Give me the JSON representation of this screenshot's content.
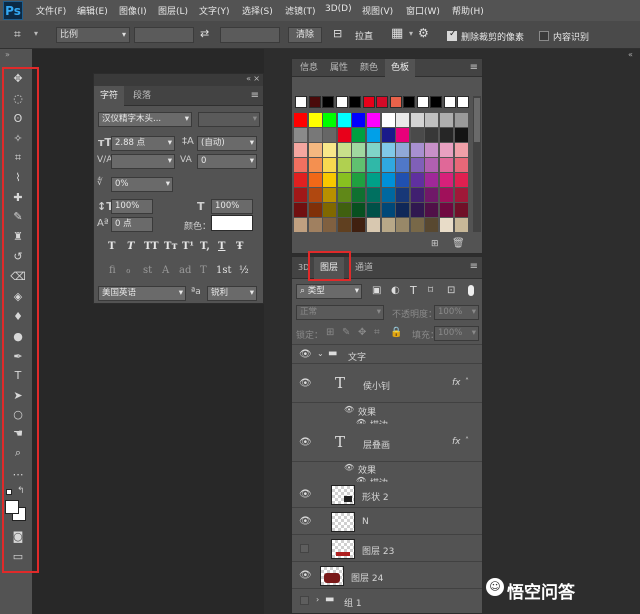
{
  "app": {
    "logo": "Ps"
  },
  "menu": [
    "文件(F)",
    "编辑(E)",
    "图像(I)",
    "图层(L)",
    "文字(Y)",
    "选择(S)",
    "滤镜(T)",
    "3D(D)",
    "视图(V)",
    "窗口(W)",
    "帮助(H)"
  ],
  "options": {
    "ratio": "比例",
    "clear": "清除",
    "straighten": "拉直",
    "delete_cropped": "删除裁剪的像素",
    "content_aware": "内容识别"
  },
  "char_panel": {
    "tabs": [
      "字符",
      "段落"
    ],
    "font_family": "汉仪精字木头...",
    "font_size": "2.88 点",
    "leading": "(自动)",
    "tracking": "0",
    "scale_percent": "0%",
    "vertical_scale": "100%",
    "horizontal_scale": "100%",
    "baseline_shift": "0 点",
    "color_label": "颜色：",
    "style_buttons": [
      "T",
      "T",
      "TT",
      "Tт",
      "T¹",
      "T,",
      "T",
      "Ŧ"
    ],
    "opentype_buttons": [
      "fi",
      "ℴ",
      "st",
      "A",
      "ad",
      "T",
      "1st",
      "½"
    ],
    "language": "美国英语",
    "aa_label": "ªa",
    "antialias": "锐利"
  },
  "swatch_panel": {
    "tabs": [
      "信息",
      "属性",
      "颜色",
      "色板"
    ],
    "top_row": [
      "#ffffff",
      "#4a0a0a",
      "#000000",
      "#ffffff",
      "#000000",
      "#e8001a",
      "#d40a28",
      "#e8624a",
      "#000000",
      "#ffffff",
      "#000000",
      "#ffffff",
      "#ffffff"
    ],
    "grid": [
      [
        "#ff0000",
        "#ffff00",
        "#00ff00",
        "#00ffff",
        "#0000ff",
        "#ff00ff",
        "#ffffff",
        "#e8e8e8",
        "#d4d4d4",
        "#c0c0c0",
        "#aeaeae",
        "#9a9a9a"
      ],
      [
        "#8a8a8a",
        "#787878",
        "#666666",
        "#e8001a",
        "#00a040",
        "#00a0e8",
        "#1a1a8a",
        "#e8007a",
        "#4a4a4a",
        "#383838",
        "#262626",
        "#141414"
      ],
      [
        "#f4a6a0",
        "#f4b880",
        "#f8e88a",
        "#c8e08a",
        "#a0d8a0",
        "#80d4c8",
        "#80c8e8",
        "#90a8d8",
        "#a890d0",
        "#c890c8",
        "#e8a0c0",
        "#f0a0a8"
      ],
      [
        "#f07060",
        "#f49050",
        "#f8d850",
        "#b0d050",
        "#60c070",
        "#30b8a8",
        "#30a8e0",
        "#5078c8",
        "#8060b8",
        "#b060b0",
        "#e06898",
        "#e86878"
      ],
      [
        "#e02020",
        "#f06818",
        "#f8c800",
        "#88c020",
        "#20a040",
        "#00a088",
        "#0090d8",
        "#2050b0",
        "#6030a0",
        "#a02898",
        "#d8207a",
        "#e02050"
      ],
      [
        "#a01818",
        "#b04810",
        "#b89000",
        "#608818",
        "#107030",
        "#007060",
        "#0068a0",
        "#183878",
        "#402070",
        "#701868",
        "#a0105a",
        "#a01838"
      ],
      [
        "#701010",
        "#803008",
        "#806800",
        "#406010",
        "#085020",
        "#005048",
        "#004878",
        "#102858",
        "#301850",
        "#501048",
        "#700840",
        "#701028"
      ],
      [
        "#c0a080",
        "#a08060",
        "#806040",
        "#604020",
        "#402010",
        "#d8c8b0",
        "#b8a888",
        "#988868",
        "#786848",
        "#584830",
        "#e8dcc8",
        "#c8b898"
      ]
    ]
  },
  "layer_panel": {
    "tabs": [
      "3D",
      "图层",
      "通道"
    ],
    "filter_kind": "类型",
    "blend_mode": "正常",
    "opacity_label": "不透明度：",
    "opacity_value": "100%",
    "lock_label": "锁定：",
    "fill_label": "填充：",
    "fill_value": "100%",
    "rows": [
      {
        "name": "文字",
        "type": "group"
      },
      {
        "name": "侯小钊",
        "type": "text",
        "fx": "fx"
      },
      {
        "name": "效果",
        "type": "effect"
      },
      {
        "name": "描边",
        "type": "effect-item"
      },
      {
        "name": "层叠画",
        "type": "text",
        "fx": "fx"
      },
      {
        "name": "效果",
        "type": "effect"
      },
      {
        "name": "描边",
        "type": "effect-item"
      },
      {
        "name": "形状 2",
        "type": "shape"
      },
      {
        "name": "N",
        "type": "pixel"
      },
      {
        "name": "图层 23",
        "type": "pixel"
      },
      {
        "name": "图层 24",
        "type": "pixel"
      },
      {
        "name": "组 1",
        "type": "group"
      }
    ]
  },
  "watermark": "悟空问答"
}
